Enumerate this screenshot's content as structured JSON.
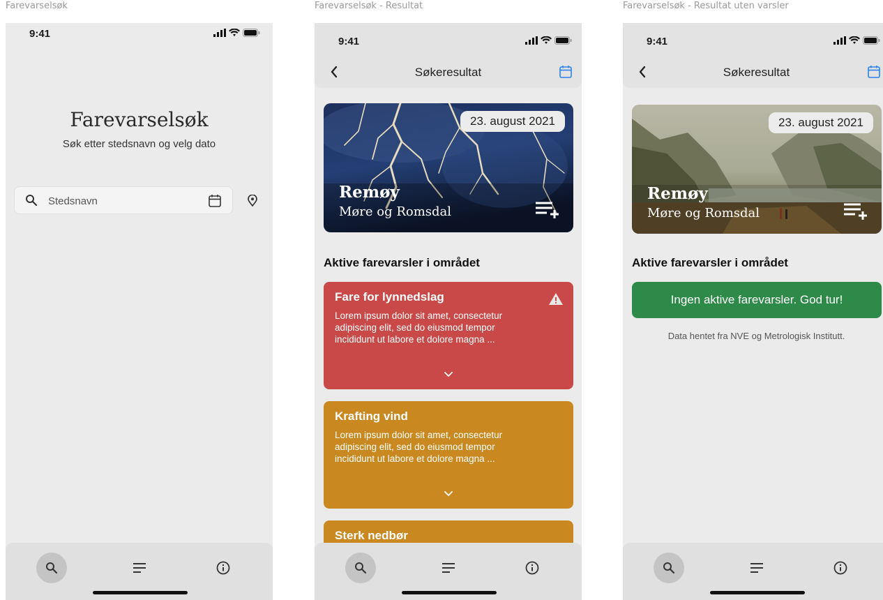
{
  "frames": [
    {
      "label": "Farevarselsøk"
    },
    {
      "label": "Farevarselsøk - Resultat"
    },
    {
      "label": "Farevarselsøk - Resultat uten varsler"
    }
  ],
  "status": {
    "time": "9:41"
  },
  "search_screen": {
    "title": "Farevarselsøk",
    "subtitle": "Søk etter stedsnavn og velg dato",
    "search_placeholder": "Stedsnavn"
  },
  "result_header": {
    "title": "Søkeresultat"
  },
  "hero": {
    "date": "23. august 2021",
    "place": "Remøy",
    "region": "Møre og Romsdal"
  },
  "alerts_section_title": "Aktive farevarsler i området",
  "alerts": [
    {
      "title": "Fare for lynnedslag",
      "body": "Lorem ipsum dolor sit amet, consectetur adipiscing elit, sed do eiusmod tempor incididunt ut labore et dolore magna ...",
      "color": "#c94848"
    },
    {
      "title": "Krafting vind",
      "body": "Lorem ipsum dolor sit amet, consectetur adipiscing elit, sed do eiusmod tempor incididunt ut labore et dolore magna ...",
      "color": "#ca8820"
    },
    {
      "title": "Sterk nedbør",
      "color": "#ca8820"
    }
  ],
  "no_alerts": {
    "message": "Ingen aktive farevarsler. God tur!",
    "source": "Data hentet fra NVE og Metrologisk Institutt.",
    "color": "#2e8a48"
  },
  "icons": {
    "search": "search-icon",
    "calendar": "calendar-icon",
    "location": "location-pin-icon",
    "back": "back-chevron-icon",
    "add_list": "add-to-list-icon",
    "warning": "warning-icon",
    "expand": "chevron-down-icon",
    "list": "list-icon",
    "info": "info-icon"
  },
  "accent_color": "#2f80ed"
}
